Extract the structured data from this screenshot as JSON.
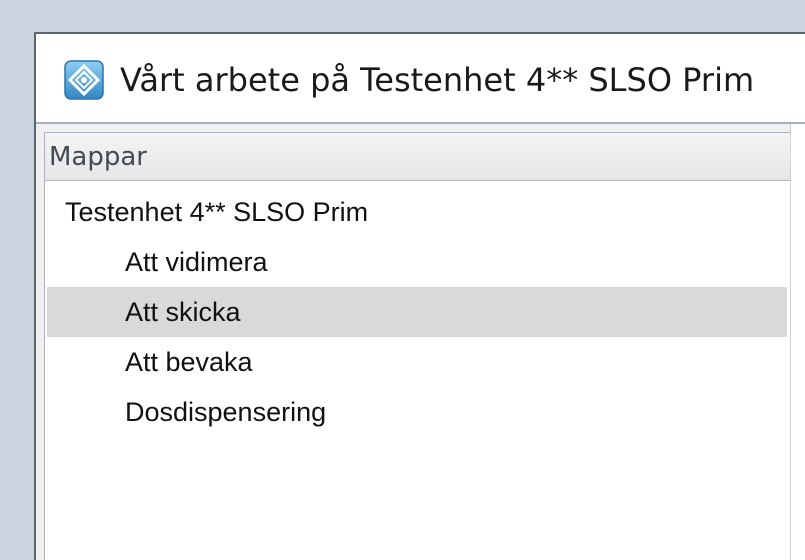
{
  "window": {
    "title": "Vårt arbete på Testenhet 4** SLSO Prim",
    "icon": "diamond-app-icon"
  },
  "folders_pane": {
    "title": "Mappar",
    "root": "Testenhet 4** SLSO Prim",
    "items": [
      {
        "label": "Att vidimera",
        "selected": false
      },
      {
        "label": "Att skicka",
        "selected": true
      },
      {
        "label": "Att bevaka",
        "selected": false
      },
      {
        "label": "Dosdispensering",
        "selected": false
      }
    ]
  },
  "colors": {
    "selection": "#d9d9d9",
    "icon_blue": "#4d9bd0"
  }
}
